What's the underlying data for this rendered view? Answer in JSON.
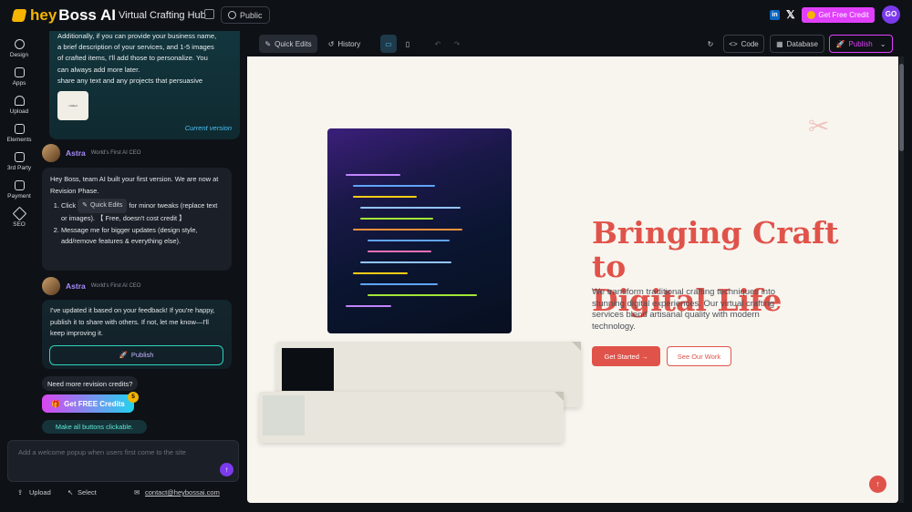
{
  "topbar": {
    "logo_hey": "hey",
    "logo_boss": "Boss AI",
    "app_title": "Virtual Crafting Hub",
    "public_label": "Public",
    "credit_label": "Get Free Credit",
    "avatar_initials": "GO"
  },
  "leftnav": {
    "items": [
      {
        "label": "Design",
        "icon": "palette-icon"
      },
      {
        "label": "Apps",
        "icon": "apps-grid-icon"
      },
      {
        "label": "Upload",
        "icon": "cloud-upload-icon"
      },
      {
        "label": "Elements",
        "icon": "elements-grid-icon"
      },
      {
        "label": "3rd Party",
        "icon": "storefront-icon"
      },
      {
        "label": "Payment",
        "icon": "wallet-icon"
      },
      {
        "label": "SEO",
        "icon": "magic-wand-icon"
      }
    ]
  },
  "chat": {
    "msg1_lines": [
      "Additionally, if you can provide your business name,",
      "a brief description of your services, and 1-5 images",
      "of crafted items, I'll add those to personalize. You",
      "can always add more later.",
      "share any text and any projects that persuasive"
    ],
    "thumb_text": "crafted",
    "current_version": "Current version",
    "author_name": "Astra",
    "author_role": "World's First AI CEO",
    "msg2_intro": "Hey Boss, team AI built your first version. We are now at Revision Phase.",
    "msg2_click": "Click",
    "quick_edits_chip": "Quick Edits",
    "msg2_item1_rest": "for minor tweaks (replace text or images). 【 Free, doesn't cost credit 】",
    "msg2_item2": "Message me for bigger updates (design style, add/remove features & everything else).",
    "msg3": "I've updated it based on your feedback! If you're happy, publish it to share with others. If not, let me know—I'll keep improving it.",
    "publish_inline": "Publish",
    "need_credits": "Need more revision credits?",
    "free_credits_btn": "Get FREE Credits",
    "credits_badge": "5",
    "make_clickable": "Make all buttons clickable.",
    "input_placeholder": "Add a welcome popup when users first come to the site",
    "upload_label": "Upload",
    "select_label": "Select",
    "contact_email": "contact@heybossai.com"
  },
  "preview_toolbar": {
    "quick_edits": "Quick Edits",
    "history": "History",
    "code": "Code",
    "database": "Database",
    "publish": "Publish"
  },
  "site": {
    "headline_line1": "Bringing Craft to",
    "headline_line2": "Digital Life",
    "subtext": "We transform traditional crafting techniques into stunning digital experiences. Our virtual crafting services blend artisanal quality with modern technology.",
    "get_started": "Get Started →",
    "see_work": "See Our Work"
  },
  "colors": {
    "accent_red": "#e0534a",
    "brand_purple": "#7c3aed",
    "credit_pink": "#e040fb",
    "teal": "#2dd4bf"
  }
}
